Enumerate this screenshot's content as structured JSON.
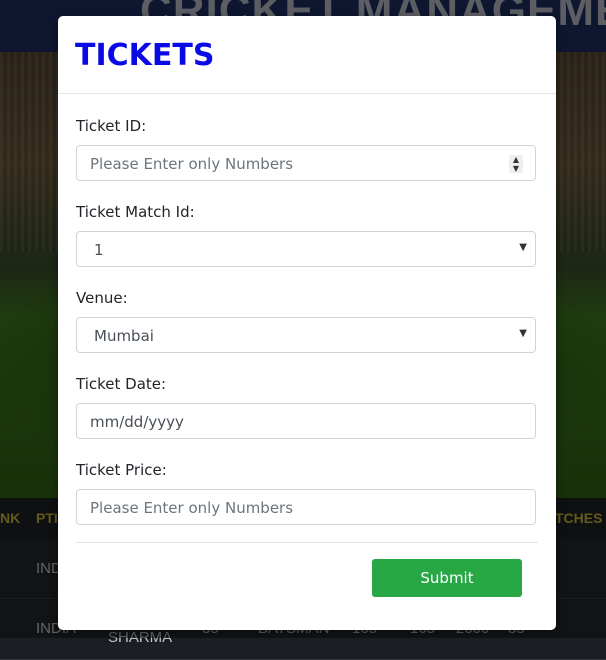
{
  "background": {
    "header_title": "CRICKET MANAGEMENT",
    "table_headers": [
      "NK",
      "PTI",
      "TCHES"
    ],
    "rows": [
      {
        "cells": [
          "INDI"
        ]
      },
      {
        "cells": [
          "INDIA",
          "SHARMA",
          "35",
          "BATSMAN",
          "165",
          "165",
          "2000",
          "85"
        ]
      }
    ]
  },
  "modal": {
    "title": "TICKETS",
    "fields": [
      {
        "label": "Ticket ID:",
        "placeholder": "Please Enter only Numbers",
        "type": "number"
      },
      {
        "label": "Ticket Match Id:",
        "value": "1",
        "type": "select"
      },
      {
        "label": "Venue:",
        "value": "Mumbai",
        "type": "select"
      },
      {
        "label": "Ticket Date:",
        "placeholder": "mm/dd/yyyy",
        "type": "date"
      },
      {
        "label": "Ticket Price:",
        "placeholder": "Please Enter only Numbers",
        "type": "text"
      }
    ],
    "submit_label": "Submit"
  },
  "colors": {
    "title": "#0a0ae6",
    "submit": "#28a745",
    "table_header_text": "#c9b43a"
  }
}
